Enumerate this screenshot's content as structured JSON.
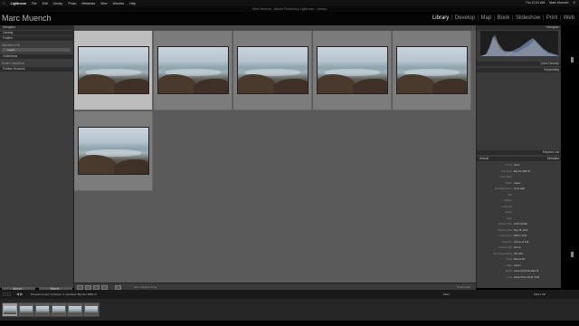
{
  "menubar": {
    "apple": "",
    "app": "Lightroom",
    "items": [
      "File",
      "Edit",
      "Library",
      "Photo",
      "Metadata",
      "View",
      "Window",
      "Help"
    ],
    "right": [
      "Thu 10:11 AM",
      "Marc Muench"
    ]
  },
  "window_title": "Marc Muench - Adobe Photoshop Lightroom - Library",
  "identity": {
    "name": "Marc Muench"
  },
  "modules": [
    "Library",
    "Develop",
    "Map",
    "Book",
    "Slideshow",
    "Print",
    "Web"
  ],
  "active_module": "Library",
  "left_panel": {
    "navigator": "Navigator",
    "catalog": "Catalog",
    "folders": "Folders",
    "folder_item": "export",
    "collections": "Collections",
    "collection_item": "Smart Collections",
    "publish": "Publish Services",
    "import_button": "Import...",
    "export_button": "Export..."
  },
  "right_panel": {
    "histogram": "Histogram",
    "quick_develop": "Quick Develop",
    "keywording": "Keywording",
    "keyword_list": "Keyword List",
    "metadata": "Metadata",
    "comments": "Comments",
    "metadata_preset": "Default",
    "rows": [
      {
        "k": "Preset",
        "v": "None"
      },
      {
        "k": "File Name",
        "v": "Big Sur 0381.tif"
      },
      {
        "k": "Copy Name",
        "v": ""
      },
      {
        "k": "Folder",
        "v": "export"
      },
      {
        "k": "Metadata Status",
        "v": "Up to date"
      },
      {
        "k": "Title",
        "v": ""
      },
      {
        "k": "Caption",
        "v": ""
      },
      {
        "k": "Copyright",
        "v": ""
      },
      {
        "k": "Rating",
        "v": ""
      },
      {
        "k": "Label",
        "v": ""
      },
      {
        "k": "Capture Time",
        "v": "10:07:22 AM"
      },
      {
        "k": "Capture Date",
        "v": "Sep 15, 2012"
      },
      {
        "k": "Dimensions",
        "v": "5616 x 3744"
      },
      {
        "k": "Exposure",
        "v": "1/8 sec at f/16"
      },
      {
        "k": "Focal Length",
        "v": "24 mm"
      },
      {
        "k": "ISO Speed Rating",
        "v": "ISO 100"
      },
      {
        "k": "Flash",
        "v": "Did not fire"
      },
      {
        "k": "Make",
        "v": "Canon"
      },
      {
        "k": "Model",
        "v": "Canon EOS 5D Mark III"
      },
      {
        "k": "Lens",
        "v": "EF24-70mm f/2.8L USM"
      }
    ]
  },
  "toolbar": {
    "sort_label": "Sort: Capture Time",
    "thumbnails_label": "Thumbnails"
  },
  "filmstrip": {
    "source": "Previous Import  6 photos / 1 selected / Big Sur 0381.tif",
    "filter_label": "Filter:",
    "filter_value": "Filters Off"
  }
}
